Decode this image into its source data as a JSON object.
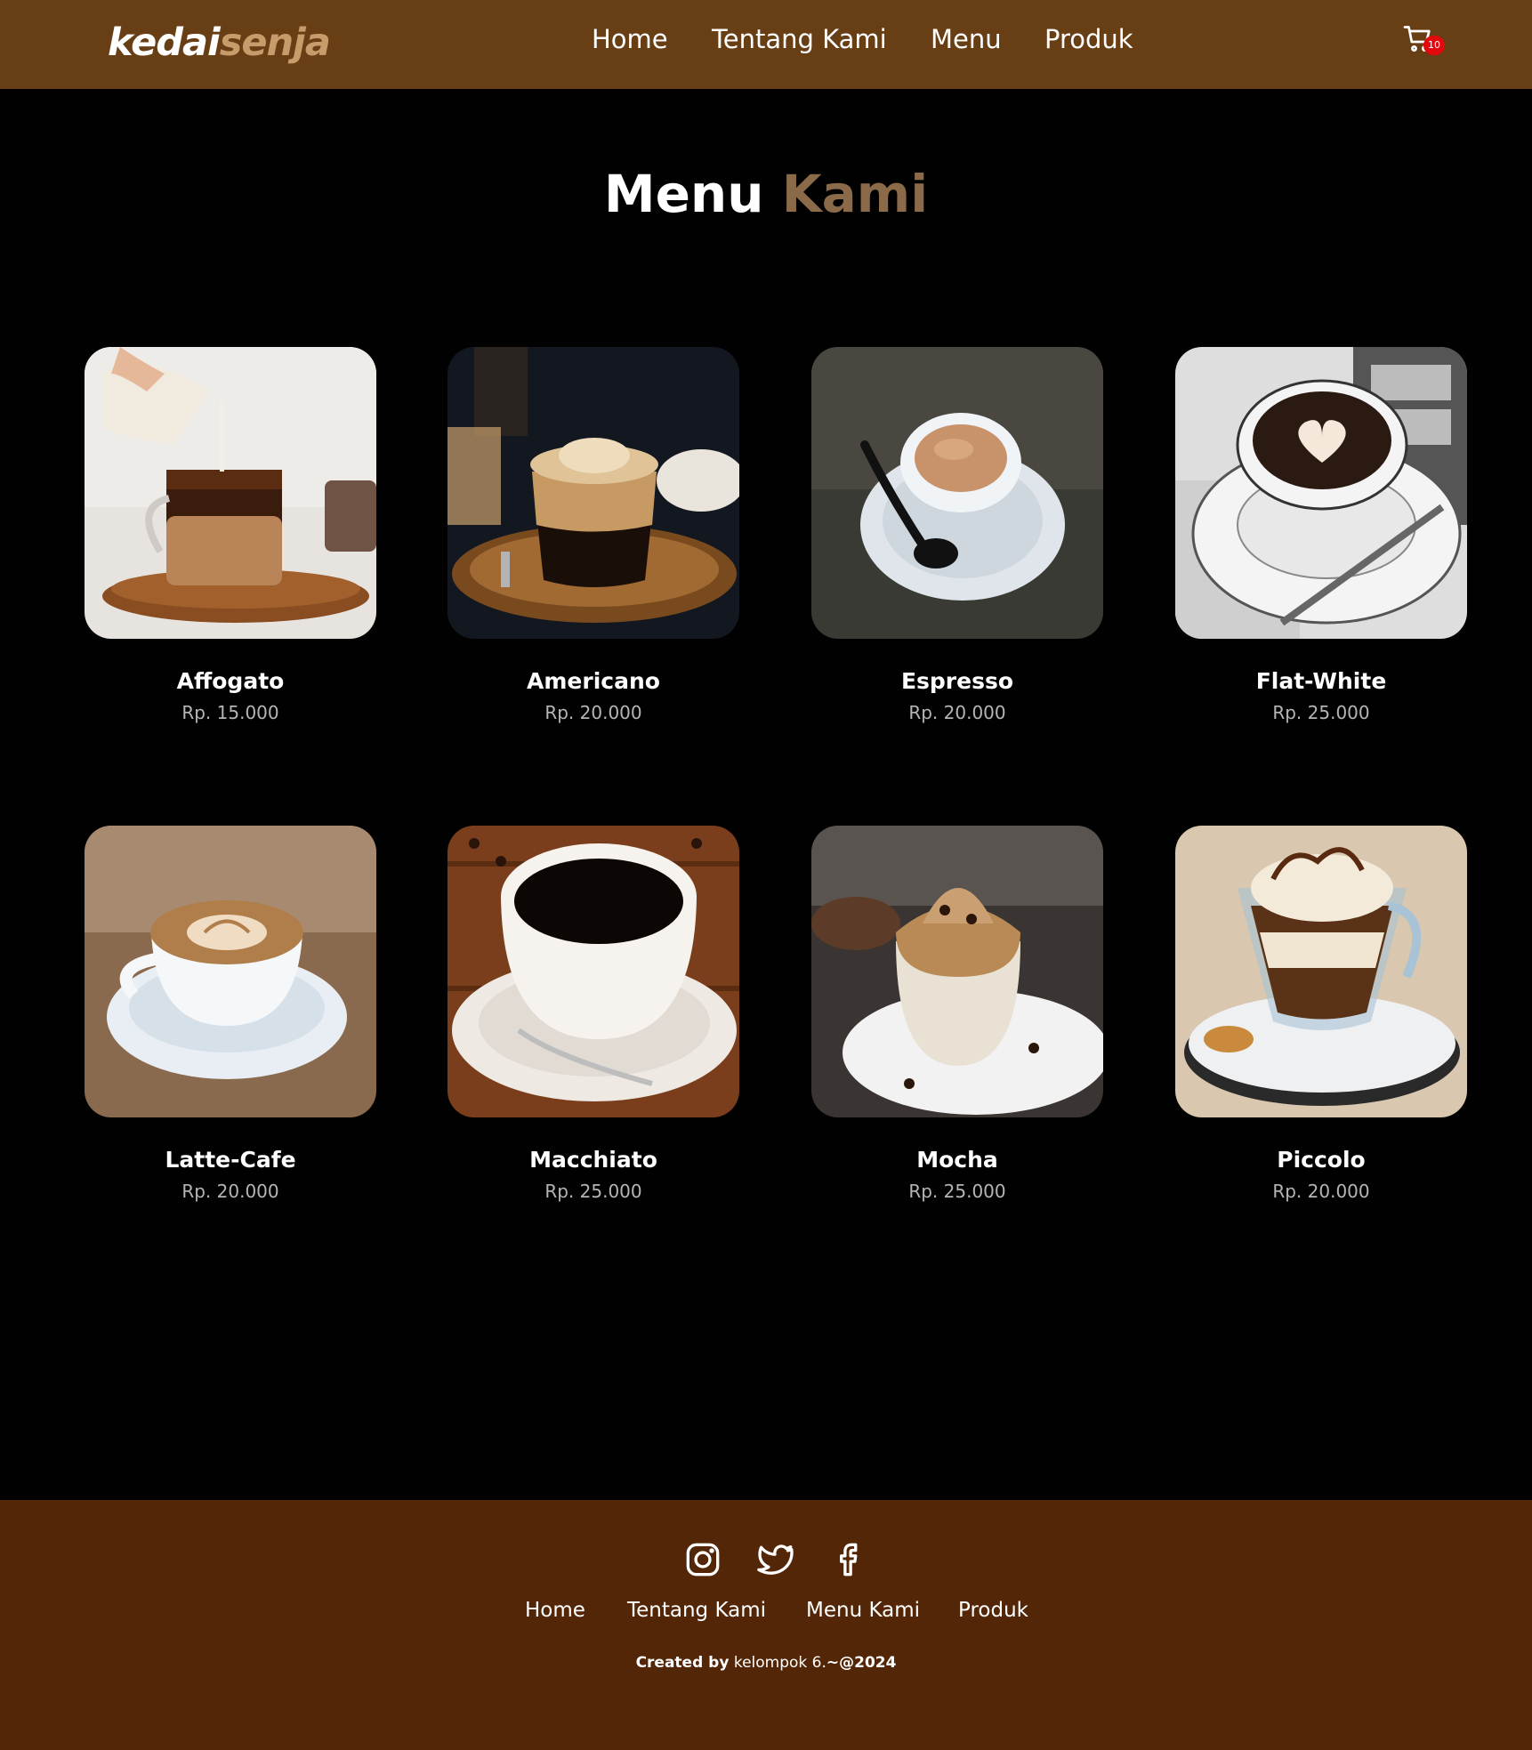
{
  "header": {
    "logo_part1": "kedai",
    "logo_part2": "senja",
    "nav": [
      "Home",
      "Tentang Kami",
      "Menu",
      "Produk"
    ],
    "cart_count": "10"
  },
  "section": {
    "title_part1": "Menu",
    "title_part2": "Kami"
  },
  "menu": [
    {
      "name": "Affogato",
      "price": "Rp. 15.000"
    },
    {
      "name": "Americano",
      "price": "Rp. 20.000"
    },
    {
      "name": "Espresso",
      "price": "Rp. 20.000"
    },
    {
      "name": "Flat-White",
      "price": "Rp. 25.000"
    },
    {
      "name": "Latte-Cafe",
      "price": "Rp. 20.000"
    },
    {
      "name": "Macchiato",
      "price": "Rp. 25.000"
    },
    {
      "name": "Mocha",
      "price": "Rp. 25.000"
    },
    {
      "name": "Piccolo",
      "price": "Rp. 20.000"
    }
  ],
  "footer": {
    "socials": [
      "instagram-icon",
      "twitter-icon",
      "facebook-icon"
    ],
    "links": [
      "Home",
      "Tentang Kami",
      "Menu Kami",
      "Produk"
    ],
    "credit_prefix": "Created by",
    "credit_name": "kelompok 6.",
    "credit_suffix": "~@2024"
  },
  "colors": {
    "navbar": "#683e15",
    "footer": "#522606",
    "accent": "#8a6a48",
    "logo_accent": "#c89b6b",
    "badge": "#e3070e",
    "background": "#010101"
  }
}
